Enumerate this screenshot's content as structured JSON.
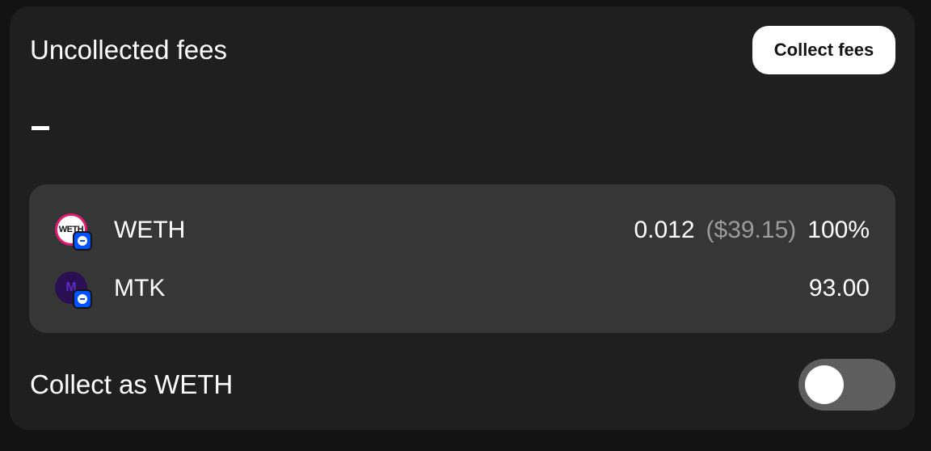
{
  "header": {
    "title": "Uncollected fees",
    "collect_button_label": "Collect fees"
  },
  "fees_total": "",
  "tokens": [
    {
      "symbol": "WETH",
      "logo_text": "WETH",
      "amount": "0.012",
      "usd_value": "($39.15)",
      "percent": "100%",
      "icon": "weth-token-icon",
      "chain_icon": "chain-badge-icon"
    },
    {
      "symbol": "MTK",
      "logo_text": "M",
      "amount": "93.00",
      "icon": "mtk-token-icon",
      "chain_icon": "chain-badge-icon"
    }
  ],
  "convert_toggle": {
    "label": "Collect as WETH",
    "enabled": false
  },
  "colors": {
    "background": "#131313",
    "card": "#1f1f1f",
    "token_box": "#363636",
    "toggle_off": "#5e5e5e",
    "weth_ring": "#e0186f",
    "chain_badge": "#0052ff",
    "muted_text": "#9b9b9b"
  }
}
